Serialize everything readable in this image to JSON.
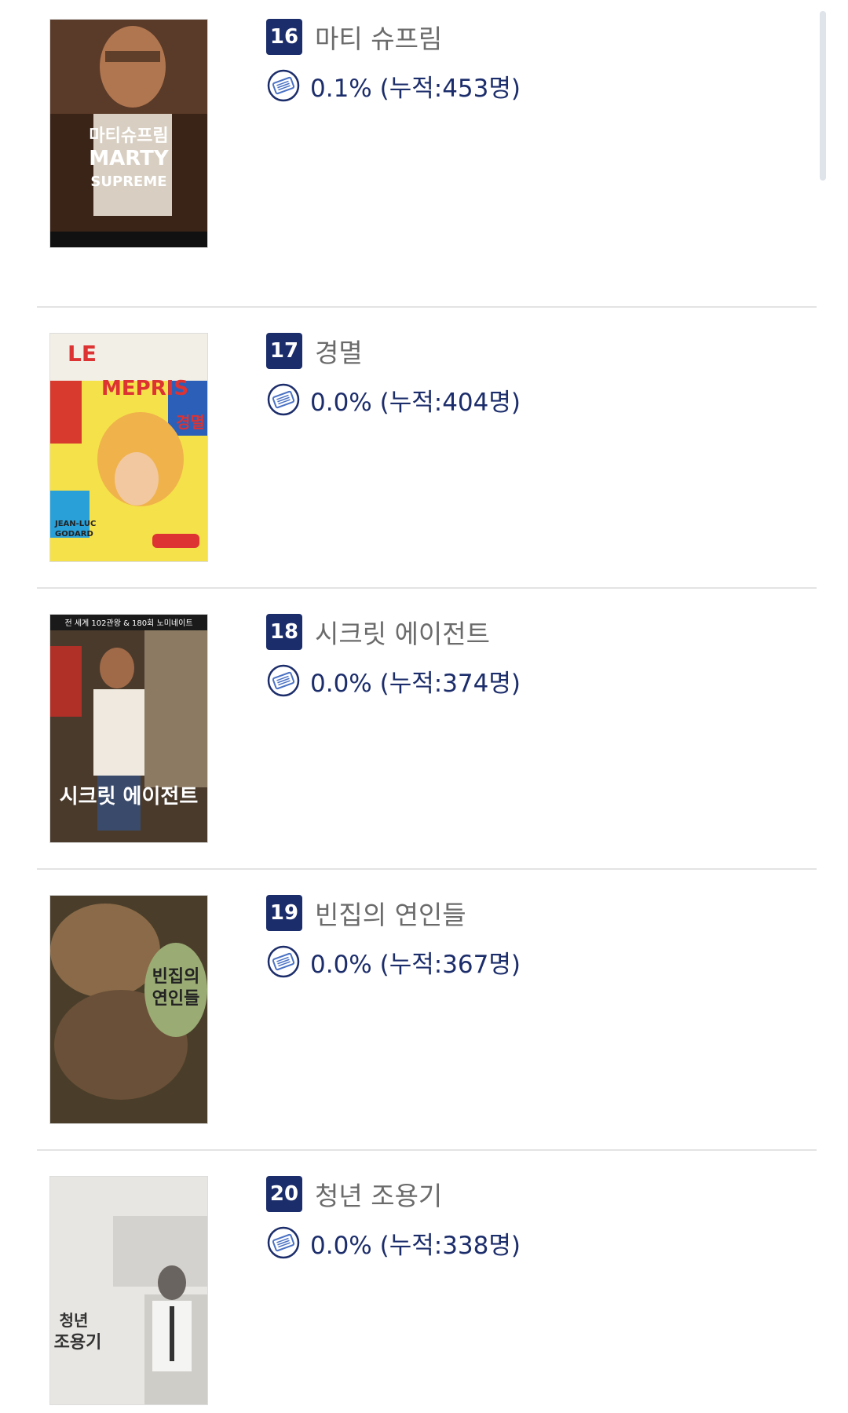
{
  "movies": [
    {
      "rank": "16",
      "title": "마티 슈프림",
      "share": "0.1% (누적:453명)"
    },
    {
      "rank": "17",
      "title": "경멸",
      "share": "0.0% (누적:404명)"
    },
    {
      "rank": "18",
      "title": "시크릿 에이전트",
      "share": "0.0% (누적:374명)"
    },
    {
      "rank": "19",
      "title": "빈집의 연인들",
      "share": "0.0% (누적:367명)"
    },
    {
      "rank": "20",
      "title": "청년 조용기",
      "share": "0.0% (누적:338명)"
    }
  ],
  "posters": [
    {
      "text_lines": [
        "마티슈프림",
        "MARTY",
        "SUPREME"
      ]
    },
    {
      "text_lines": [
        "LE",
        "MEPRIS",
        "경멸",
        "JEAN-LUC",
        "GODARD"
      ]
    },
    {
      "text_lines": [
        "전 세계 102관왕 & 180회 노미네이트",
        "시크릿 에이전트"
      ]
    },
    {
      "text_lines": [
        "빈집의",
        "연인들"
      ]
    },
    {
      "text_lines": [
        "청년",
        "조용기"
      ]
    }
  ],
  "colors": {
    "rank_badge": "#1c2d6b",
    "share_text": "#1c2d6b",
    "title_text": "#6b6b6b"
  },
  "icons": {
    "share_icon": "ticket-icon"
  }
}
